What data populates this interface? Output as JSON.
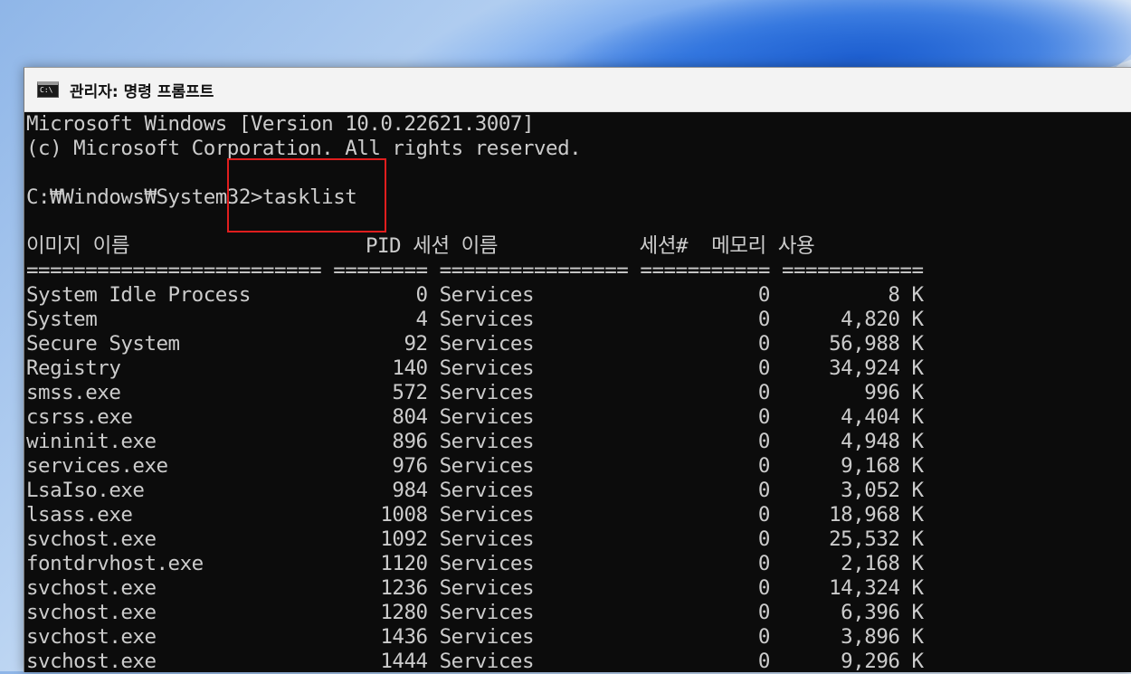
{
  "window": {
    "title": "관리자: 명령 프롬프트",
    "icon": "cmd-icon",
    "icon_text": "C:\\"
  },
  "console": {
    "banner": [
      "Microsoft Windows [Version 10.0.22621.3007]",
      "(c) Microsoft Corporation. All rights reserved."
    ],
    "prompt": "C:₩Windows₩System32>",
    "command": "tasklist",
    "header": "이미지 이름                    PID 세션 이름            세션#  메모리 사용",
    "separator": "========================= ======== ================ =========== ============",
    "processes": [
      {
        "name": "System Idle Process",
        "pid": "0",
        "session_name": "Services",
        "session": "0",
        "mem": "8 K"
      },
      {
        "name": "System",
        "pid": "4",
        "session_name": "Services",
        "session": "0",
        "mem": "4,820 K"
      },
      {
        "name": "Secure System",
        "pid": "92",
        "session_name": "Services",
        "session": "0",
        "mem": "56,988 K"
      },
      {
        "name": "Registry",
        "pid": "140",
        "session_name": "Services",
        "session": "0",
        "mem": "34,924 K"
      },
      {
        "name": "smss.exe",
        "pid": "572",
        "session_name": "Services",
        "session": "0",
        "mem": "996 K"
      },
      {
        "name": "csrss.exe",
        "pid": "804",
        "session_name": "Services",
        "session": "0",
        "mem": "4,404 K"
      },
      {
        "name": "wininit.exe",
        "pid": "896",
        "session_name": "Services",
        "session": "0",
        "mem": "4,948 K"
      },
      {
        "name": "services.exe",
        "pid": "976",
        "session_name": "Services",
        "session": "0",
        "mem": "9,168 K"
      },
      {
        "name": "LsaIso.exe",
        "pid": "984",
        "session_name": "Services",
        "session": "0",
        "mem": "3,052 K"
      },
      {
        "name": "lsass.exe",
        "pid": "1008",
        "session_name": "Services",
        "session": "0",
        "mem": "18,968 K"
      },
      {
        "name": "svchost.exe",
        "pid": "1092",
        "session_name": "Services",
        "session": "0",
        "mem": "25,532 K"
      },
      {
        "name": "fontdrvhost.exe",
        "pid": "1120",
        "session_name": "Services",
        "session": "0",
        "mem": "2,168 K"
      },
      {
        "name": "svchost.exe",
        "pid": "1236",
        "session_name": "Services",
        "session": "0",
        "mem": "14,324 K"
      },
      {
        "name": "svchost.exe",
        "pid": "1280",
        "session_name": "Services",
        "session": "0",
        "mem": "6,396 K"
      },
      {
        "name": "svchost.exe",
        "pid": "1436",
        "session_name": "Services",
        "session": "0",
        "mem": "3,896 K"
      },
      {
        "name": "svchost.exe",
        "pid": "1444",
        "session_name": "Services",
        "session": "0",
        "mem": "9,296 K"
      }
    ]
  },
  "colors": {
    "console_bg": "#0c0c0c",
    "console_fg": "#cccccc",
    "highlight": "#e01e1e"
  }
}
